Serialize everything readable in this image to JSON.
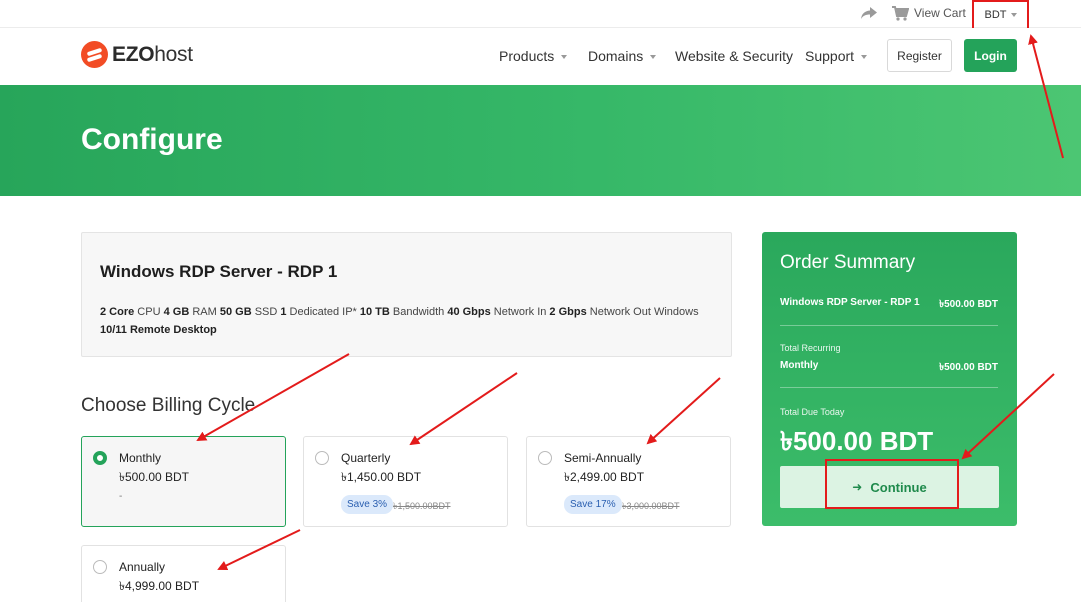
{
  "topbar": {
    "view_cart": "View Cart",
    "currency": "BDT"
  },
  "header": {
    "logo_bold": "EZO",
    "logo_rest": "host",
    "nav": [
      "Products",
      "Domains",
      "Website & Security",
      "Support"
    ],
    "register": "Register",
    "login": "Login"
  },
  "banner": {
    "title": "Configure"
  },
  "product": {
    "name": "Windows RDP Server - RDP 1",
    "desc": [
      {
        "b": "2 Core",
        "t": " CPU "
      },
      {
        "b": "4 GB",
        "t": " RAM "
      },
      {
        "b": "50 GB",
        "t": " SSD "
      },
      {
        "b": "1",
        "t": " Dedicated IP* "
      },
      {
        "b": "10 TB",
        "t": " Bandwidth "
      },
      {
        "b": "40 Gbps",
        "t": " Network In "
      },
      {
        "b": "2 Gbps",
        "t": " Network Out Windows "
      },
      {
        "b": "10/11",
        "t": " "
      },
      {
        "b": "Remote Desktop",
        "t": ""
      }
    ]
  },
  "billing": {
    "title": "Choose Billing Cycle",
    "options": [
      {
        "name": "Monthly",
        "price": "৳500.00 BDT",
        "dash": "-",
        "selected": true
      },
      {
        "name": "Quarterly",
        "price": "৳1,450.00 BDT",
        "save": "Save 3%",
        "old": "৳1,500.00BDT",
        "selected": false
      },
      {
        "name": "Semi-Annually",
        "price": "৳2,499.00 BDT",
        "save": "Save 17%",
        "old": "৳3,000.00BDT",
        "selected": false
      },
      {
        "name": "Annually",
        "price": "৳4,999.00 BDT",
        "selected": false
      }
    ]
  },
  "summary": {
    "title": "Order Summary",
    "product": "Windows RDP Server - RDP 1",
    "product_price": "৳500.00 BDT",
    "recurring_label": "Total Recurring",
    "recurring_cycle": "Monthly",
    "recurring_price": "৳500.00 BDT",
    "due_label": "Total Due Today",
    "due_total": "৳500.00 BDT",
    "continue": "Continue"
  },
  "colors": {
    "brand_green": "#24a35a",
    "annotation_red": "#e31b1b",
    "logo_orange": "#f24c25"
  }
}
